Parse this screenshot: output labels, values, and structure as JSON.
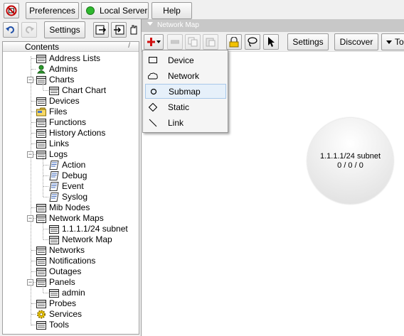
{
  "top_toolbar": {
    "preferences_label": "Preferences",
    "server_label": "Local Server",
    "server_status_color": "#2eb82e",
    "help_label": "Help"
  },
  "second_toolbar": {
    "settings_label": "Settings"
  },
  "tree": {
    "header": "Contents",
    "items": [
      {
        "label": "Address Lists",
        "icon": "table-icon"
      },
      {
        "label": "Admins",
        "icon": "admin-user-icon"
      },
      {
        "label": "Charts",
        "icon": "table-icon"
      },
      {
        "label": "Chart Chart",
        "icon": "table-icon"
      },
      {
        "label": "Devices",
        "icon": "table-icon"
      },
      {
        "label": "Files",
        "icon": "folder-icon"
      },
      {
        "label": "Functions",
        "icon": "table-icon"
      },
      {
        "label": "History Actions",
        "icon": "table-icon"
      },
      {
        "label": "Links",
        "icon": "table-icon"
      },
      {
        "label": "Logs",
        "icon": "table-icon"
      },
      {
        "label": "Action",
        "icon": "log-icon"
      },
      {
        "label": "Debug",
        "icon": "log-icon"
      },
      {
        "label": "Event",
        "icon": "log-icon"
      },
      {
        "label": "Syslog",
        "icon": "log-icon"
      },
      {
        "label": "Mib Nodes",
        "icon": "table-icon"
      },
      {
        "label": "Network Maps",
        "icon": "table-icon"
      },
      {
        "label": "1.1.1.1/24 subnet",
        "icon": "table-icon"
      },
      {
        "label": "Network Map",
        "icon": "table-icon"
      },
      {
        "label": "Networks",
        "icon": "table-icon"
      },
      {
        "label": "Notifications",
        "icon": "table-icon"
      },
      {
        "label": "Outages",
        "icon": "table-icon"
      },
      {
        "label": "Panels",
        "icon": "table-icon"
      },
      {
        "label": "admin",
        "icon": "table-icon"
      },
      {
        "label": "Probes",
        "icon": "table-icon"
      },
      {
        "label": "Services",
        "icon": "gear-icon"
      },
      {
        "label": "Tools",
        "icon": "table-icon"
      }
    ]
  },
  "map": {
    "title": "Network Map",
    "toolbar": {
      "settings_label": "Settings",
      "discover_label": "Discover",
      "tools_label": "Tools"
    },
    "add_menu": [
      {
        "label": "Device",
        "icon": "rectangle-icon"
      },
      {
        "label": "Network",
        "icon": "cloud-icon"
      },
      {
        "label": "Submap",
        "icon": "circle-icon"
      },
      {
        "label": "Static",
        "icon": "diamond-icon"
      },
      {
        "label": "Link",
        "icon": "line-icon"
      }
    ],
    "node": {
      "name": "1.1.1.1/24 subnet",
      "counts": "0 / 0 / 0"
    }
  }
}
